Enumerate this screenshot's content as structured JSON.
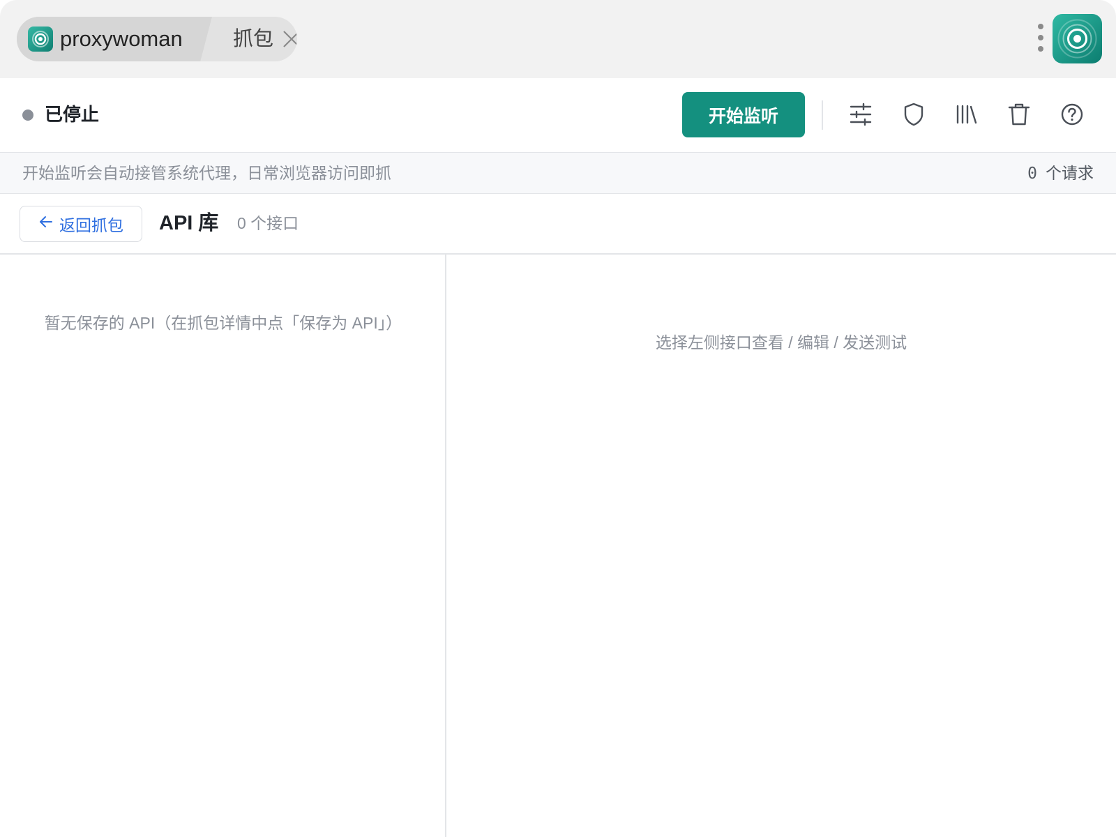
{
  "titlebar": {
    "app_tab_label": "proxywoman",
    "capture_tab_label": "抓包"
  },
  "toolbar": {
    "status_text": "已停止",
    "start_button_label": "开始监听",
    "icons": [
      "sliders-icon",
      "shield-icon",
      "library-icon",
      "trash-icon",
      "help-icon"
    ]
  },
  "hintbar": {
    "hint": "开始监听会自动接管系统代理，日常浏览器访问即抓",
    "request_count": "0",
    "request_unit": "个请求"
  },
  "section": {
    "back_label": "返回抓包",
    "title": "API 库",
    "count": "0 个接口"
  },
  "left_pane": {
    "empty_text": "暂无保存的 API（在抓包详情中点「保存为 API」）"
  },
  "right_pane": {
    "empty_text": "选择左侧接口查看 / 编辑 / 发送测试"
  },
  "colors": {
    "accent": "#14907f",
    "link": "#2f6fe0",
    "status_stopped": "#8a8f98"
  }
}
